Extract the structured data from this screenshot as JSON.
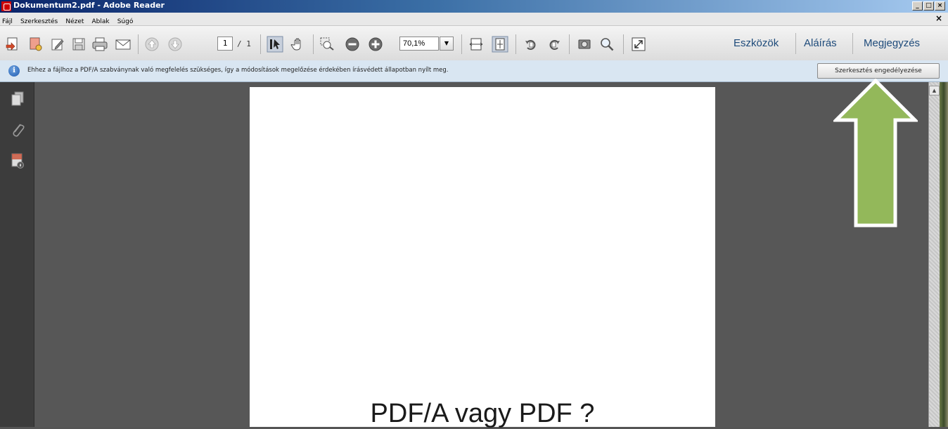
{
  "window": {
    "title": "Dokumentum2.pdf - Adobe Reader",
    "min_label": "_",
    "max_label": "□",
    "close_label": "×",
    "doc_close_label": "×"
  },
  "menu": {
    "items": [
      "Fájl",
      "Szerkesztés",
      "Nézet",
      "Ablak",
      "Súgó"
    ]
  },
  "toolbar": {
    "icons": [
      "create-pdf-icon",
      "open-icon",
      "edit-icon",
      "save-icon",
      "print-icon",
      "email-icon",
      "prev-page-icon",
      "next-page-icon",
      "select-tool-icon",
      "hand-tool-icon",
      "marquee-zoom-icon",
      "zoom-out-icon",
      "zoom-in-icon",
      "fit-page-width-icon",
      "fit-page-icon",
      "rotate-ccw-icon",
      "rotate-cw-icon",
      "snapshot-icon",
      "find-icon",
      "fullscreen-icon"
    ],
    "page_current": "1",
    "page_total": "/ 1",
    "zoom_value": "70,1%",
    "zoom_drop_glyph": "▼",
    "right_tabs": [
      "Eszközök",
      "Aláírás",
      "Megjegyzés"
    ]
  },
  "infobar": {
    "icon_label": "i",
    "message": "Ehhez a fájlhoz a PDF/A szabványnak való megfelelés szükséges, így a módosítások megelőzése érdekében írásvédett állapotban nyílt meg.",
    "button_label": "Szerkesztés engedélyezése"
  },
  "left_panel": {
    "icons": [
      "page-thumbnails-icon",
      "attachments-icon",
      "document-properties-icon"
    ]
  },
  "document": {
    "page_text": "PDF/A vagy PDF ?"
  },
  "scrollbar": {
    "up_glyph": "▲"
  },
  "annotation": {
    "arrow_color": "#93b85a"
  }
}
